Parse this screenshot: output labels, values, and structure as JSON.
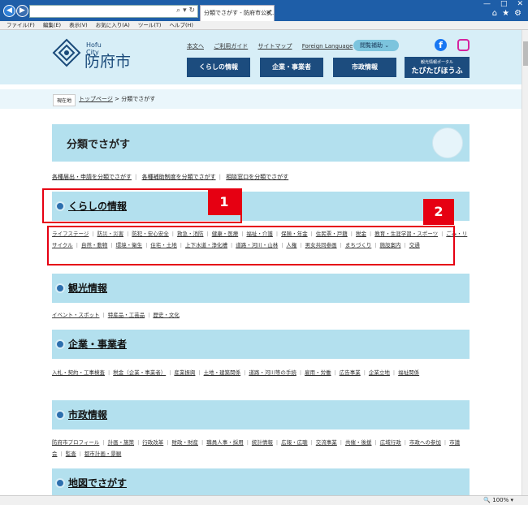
{
  "browser": {
    "tab_title": "分類でさがす - 防府市公式...",
    "menu": [
      "ファイル(F)",
      "編集(E)",
      "表示(V)",
      "お気に入り(A)",
      "ツール(T)",
      "ヘルプ(H)"
    ],
    "zoom": "100%"
  },
  "header": {
    "logo_sub": "Hofu City",
    "logo_main": "防府市",
    "top_links": [
      "本文へ",
      "ご利用ガイド",
      "サイトマップ",
      "Foreign Language"
    ],
    "read_button": "閲覧補助",
    "nav": [
      "くらしの情報",
      "企業・事業者",
      "市政情報"
    ],
    "tour_small": "観光情報ポータル",
    "tour_big": "たびたびほうふ"
  },
  "breadcrumb": {
    "here": "現在地",
    "top": "トップページ",
    "sep": ">",
    "current": "分類でさがす"
  },
  "page_title": "分類でさがす",
  "sublinks": [
    "各種届出・申請を分類でさがす",
    "各種補助制度を分類でさがす",
    "相談窓口を分類でさがす"
  ],
  "sections": [
    {
      "title": "くらしの情報",
      "links": [
        "ライフステージ",
        "防災・災害",
        "防犯・安心安全",
        "救急・消防",
        "健康・医療",
        "福祉・介護",
        "保険・年金",
        "住民票・戸籍",
        "税金",
        "教育・生涯学習・スポーツ",
        "ごみ・リサイクル",
        "自然・動物",
        "環境・衛生",
        "住宅・土地",
        "上下水道・浄化槽",
        "道路・河川・山林",
        "人権",
        "男女共同参画",
        "まちづくり",
        "施設案内",
        "交通"
      ]
    },
    {
      "title": "観光情報",
      "links": [
        "イベント・スポット",
        "特産品・工芸品",
        "歴史・文化"
      ]
    },
    {
      "title": "企業・事業者",
      "links": [
        "入札・契約・工事検査",
        "税金（企業・事業者）",
        "産業振興",
        "土地・建築関係",
        "道路・河川等の手続",
        "雇用・労働",
        "広告事業",
        "企業立地",
        "福祉関係"
      ]
    },
    {
      "title": "市政情報",
      "links": [
        "防府市プロフィール",
        "計画・施策",
        "行政改革",
        "財政・財産",
        "職員人事・採用",
        "統計情報",
        "広報・広聴",
        "交流事業",
        "共催・後援",
        "広域行政",
        "市政への参加",
        "市議会",
        "監査",
        "都市計画・景観"
      ]
    },
    {
      "title": "地図でさがす",
      "links": []
    }
  ],
  "annotations": [
    "1",
    "2"
  ],
  "colors": {
    "header_bg": "#d7eef7",
    "nav_bg": "#1c4c7e",
    "section_bg": "#b3e0ee",
    "annotation_red": "#e60012"
  }
}
